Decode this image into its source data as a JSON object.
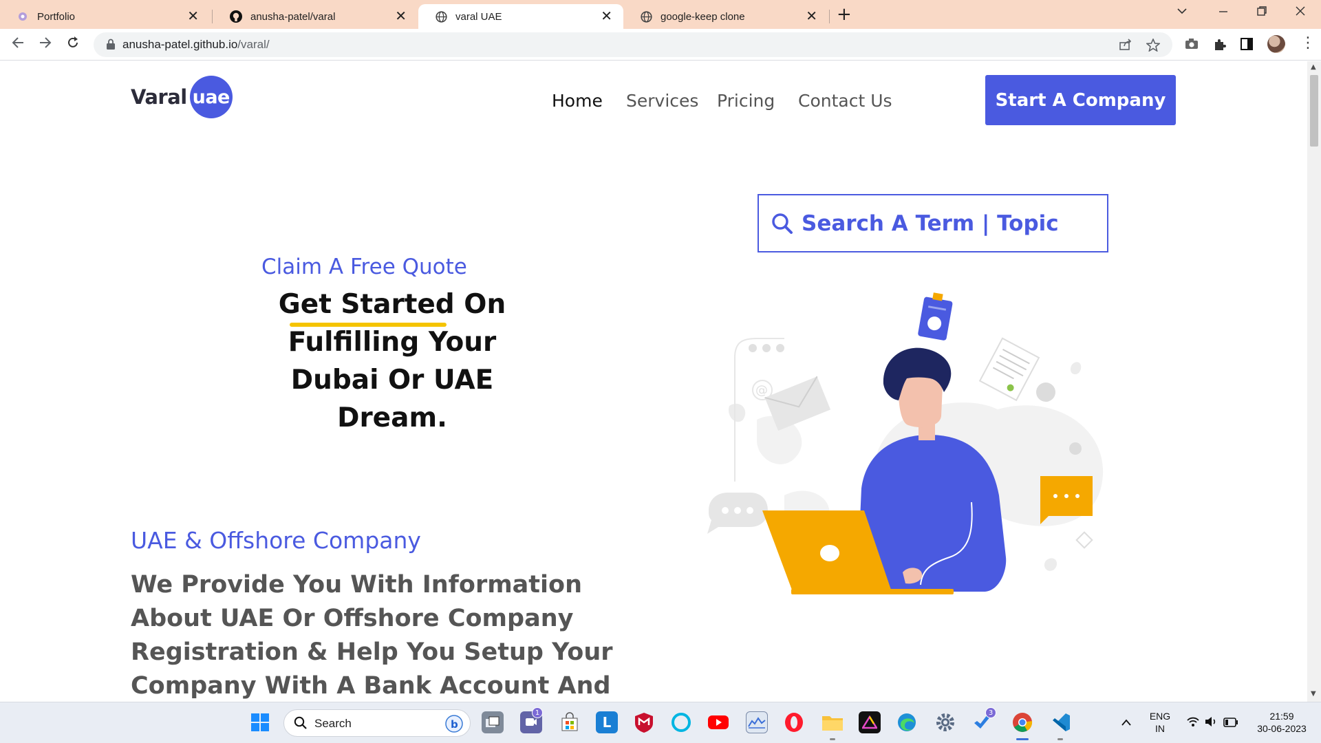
{
  "browser": {
    "tabs": [
      {
        "title": "Portfolio",
        "favicon": "portfolio-favicon",
        "active": false
      },
      {
        "title": "anusha-patel/varal",
        "favicon": "github-icon",
        "active": false
      },
      {
        "title": "varal UAE",
        "favicon": "globe-icon",
        "active": true
      },
      {
        "title": "google-keep clone",
        "favicon": "globe-icon",
        "active": false
      }
    ],
    "url_host": "anusha-patel.github.io",
    "url_path": "/varal/"
  },
  "site": {
    "logo_text": "Varal",
    "logo_badge": "uae",
    "nav": [
      "Home",
      "Services",
      "Pricing",
      "Contact Us"
    ],
    "cta": "Start A Company",
    "search_placeholder": "Search A Term | Topic",
    "claim": "Claim A Free Quote",
    "hero_title": "Get Started On Fulfilling Your Dubai Or UAE Dream.",
    "section_heading": "UAE & Offshore Company",
    "section_text": "We Provide You With Information About UAE Or Offshore Company Registration & Help You Setup Your Company With A Bank Account And Visas."
  },
  "taskbar": {
    "search_placeholder": "Search",
    "badges": {
      "teams": "1",
      "dev": "3"
    },
    "lang_top": "ENG",
    "lang_bottom": "IN",
    "time": "21:59",
    "date": "30-06-2023"
  },
  "colors": {
    "accent": "#4a5ae0",
    "highlight": "#f5c400",
    "laptop": "#f5a800",
    "tabbar": "#f9d9c6"
  }
}
